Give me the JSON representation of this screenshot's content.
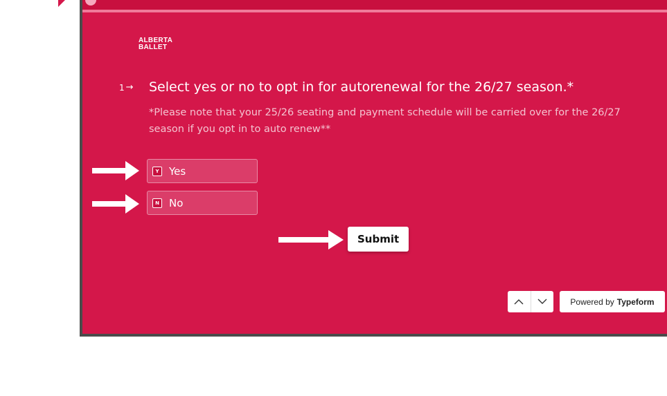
{
  "brand": {
    "logo_line1": "ALBERTA",
    "logo_line2": "BALLET",
    "accent_color": "#d4174a",
    "frame_color": "#4b4b4b"
  },
  "question": {
    "number": "1",
    "arrow_icon": "arrow-right-icon",
    "title": "Select yes or no to opt in for autorenewal for the 26/27 season.*",
    "description": "*Please note that your 25/26 seating and payment schedule will be carried over for the 26/27 season if you opt in to auto renew**"
  },
  "choices": [
    {
      "key": "Y",
      "label": "Yes"
    },
    {
      "key": "N",
      "label": "No"
    }
  ],
  "submit_label": "Submit",
  "navigation": {
    "up_icon": "chevron-up-icon",
    "down_icon": "chevron-down-icon"
  },
  "powered_by": {
    "prefix": "Powered by",
    "brand": "Typeform"
  },
  "annotations": {
    "pointer_icon": "white-arrow-pointer-icon"
  }
}
